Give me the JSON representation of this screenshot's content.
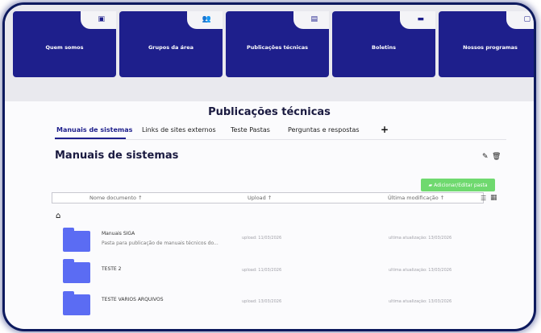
{
  "top_cards": [
    {
      "label": "Quem somos",
      "icon": "document-icon",
      "glyph": "▣"
    },
    {
      "label": "Grupos da área",
      "icon": "users-icon",
      "glyph": "👥"
    },
    {
      "label": "Publicações técnicas",
      "icon": "book-icon",
      "glyph": "▤"
    },
    {
      "label": "Boletins",
      "icon": "newspaper-icon",
      "glyph": "▬"
    },
    {
      "label": "Nossos programas",
      "icon": "program-icon",
      "glyph": "▢"
    }
  ],
  "page_title": "Publicações técnicas",
  "tabs": [
    {
      "label": "Manuais de sistemas",
      "active": true
    },
    {
      "label": "Links de sites externos",
      "active": false
    },
    {
      "label": "Teste Pastas",
      "active": false
    },
    {
      "label": "Perguntas e respostas",
      "active": false
    }
  ],
  "add_tab_label": "+",
  "section_title": "Manuais de sistemas",
  "add_folder_button": "Adicionar/Editar pasta",
  "table": {
    "columns": [
      "Nome documento ↑",
      "Upload ↑",
      "Última modificação ↑"
    ],
    "rows": [
      {
        "name": "Manuais SIGA",
        "description": "Pasta para publicação de manuais técnicos do...",
        "upload": "upload: 11/03/2026",
        "modified": "ultima atualização: 13/03/2026"
      },
      {
        "name": "TESTE 2",
        "description": "",
        "upload": "upload: 11/03/2026",
        "modified": "ultima atualização: 13/03/2026"
      },
      {
        "name": "TESTE VARIOS ARQUIVOS",
        "description": "",
        "upload": "upload: 13/03/2026",
        "modified": "ultima atualização: 13/03/2026"
      }
    ]
  },
  "colors": {
    "navy": "#1e1f8c",
    "folder": "#5b6cf3",
    "green": "#6fd96f"
  }
}
